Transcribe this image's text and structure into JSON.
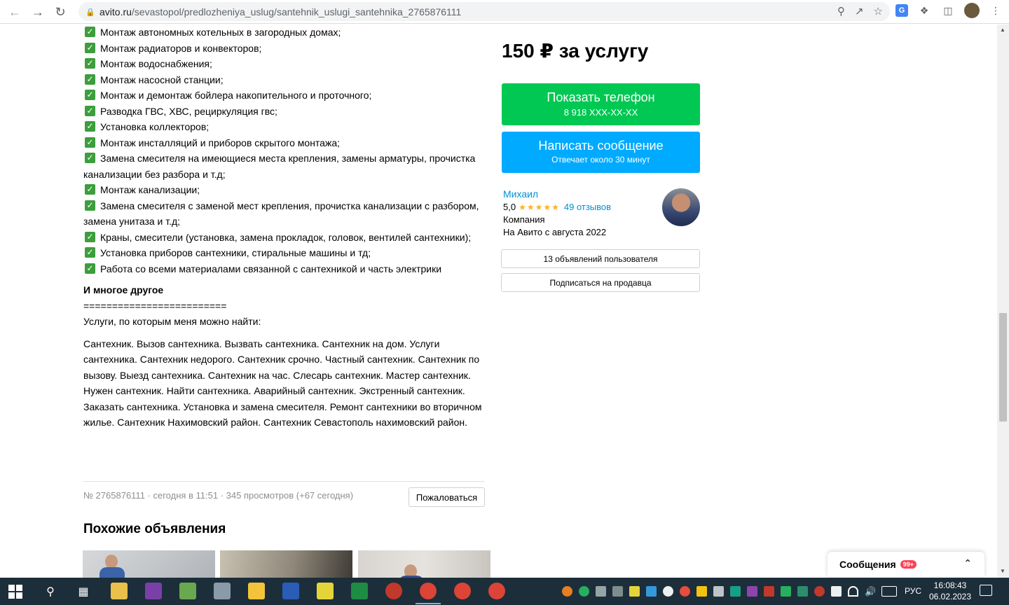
{
  "browser": {
    "url_domain": "avito.ru",
    "url_path": "/sevastopol/predlozheniya_uslug/santehnik_uslugi_santehnika_2765876111"
  },
  "description": {
    "items": [
      "Монтаж автономных котельных в загородных домах;",
      "Монтаж радиаторов и конвекторов;",
      "Монтаж водоснабжения;",
      "Монтаж насосной станции;",
      "Монтаж и демонтаж бойлера накопительного и проточного;",
      "Разводка ГВС, ХВС, рециркуляция гвс;",
      "Установка коллекторов;",
      "Монтаж инсталляций и приборов скрытого монтажа;",
      "Замена смесителя на имеющиеся места крепления, замены арматуры, прочистка канализации без разбора и т.д;",
      "Монтаж канализации;",
      "Замена смесителя с заменой мест крепления, прочистка канализации с разбором, замена унитаза и т.д;",
      "Краны, смесители (установка, замена прокладок, головок, вентилей сантехники);",
      "Установка приборов сантехники, стиральные машины и тд;",
      "Работа со всеми материалами связанной с сантехникой и часть электрики"
    ],
    "more": "И многое другое",
    "separator": "=========================",
    "search_intro": "Услуги, по которым меня можно найти:",
    "keywords": "Сантехник. Вызов сантехника. Вызвать сантехника. Сантехник на дом. Услуги сантехника. Сантехник недорого. Сантехник срочно. Частный сантехник. Сантехник по вызову. Выезд сантехника. Сантехник на час. Слесарь сантехник. Мастер сантехник. Нужен сантехник. Найти сантехника. Аварийный сантехник. Экстренный сантехник. Заказать сантехника. Установка и замена смесителя. Ремонт сантехники во вторичном жилье. Сантехник Нахимовский район. Сантехник Севастополь нахимовский район."
  },
  "meta": {
    "info": "№ 2765876111 · сегодня в 11:51 · 345 просмотров (+67 сегодня)",
    "complain": "Пожаловаться"
  },
  "similar": {
    "title": "Похожие объявления"
  },
  "sidebar": {
    "price": "150 ₽ за услугу",
    "phone_button": "Показать телефон",
    "phone_number": "8 918 XXX-XX-XX",
    "message_button": "Написать сообщение",
    "message_sub": "Отвечает около 30 минут",
    "seller_name": "Михаил",
    "rating_value": "5,0",
    "stars": "★★★★★",
    "reviews": "49 отзывов",
    "seller_type": "Компания",
    "seller_since": "На Авито с августа 2022",
    "listings_button": "13 объявлений пользователя",
    "subscribe_button": "Подписаться на продавца"
  },
  "messages_widget": {
    "label": "Сообщения",
    "badge": "99+"
  },
  "taskbar": {
    "language": "РУС",
    "time": "16:08:43",
    "date": "06.02.2023"
  },
  "colors": {
    "phone_button": "#00c853",
    "message_button": "#00aaff",
    "link": "#0091d9",
    "stars": "#ffb021",
    "checkbox": "#3c9e3c"
  }
}
